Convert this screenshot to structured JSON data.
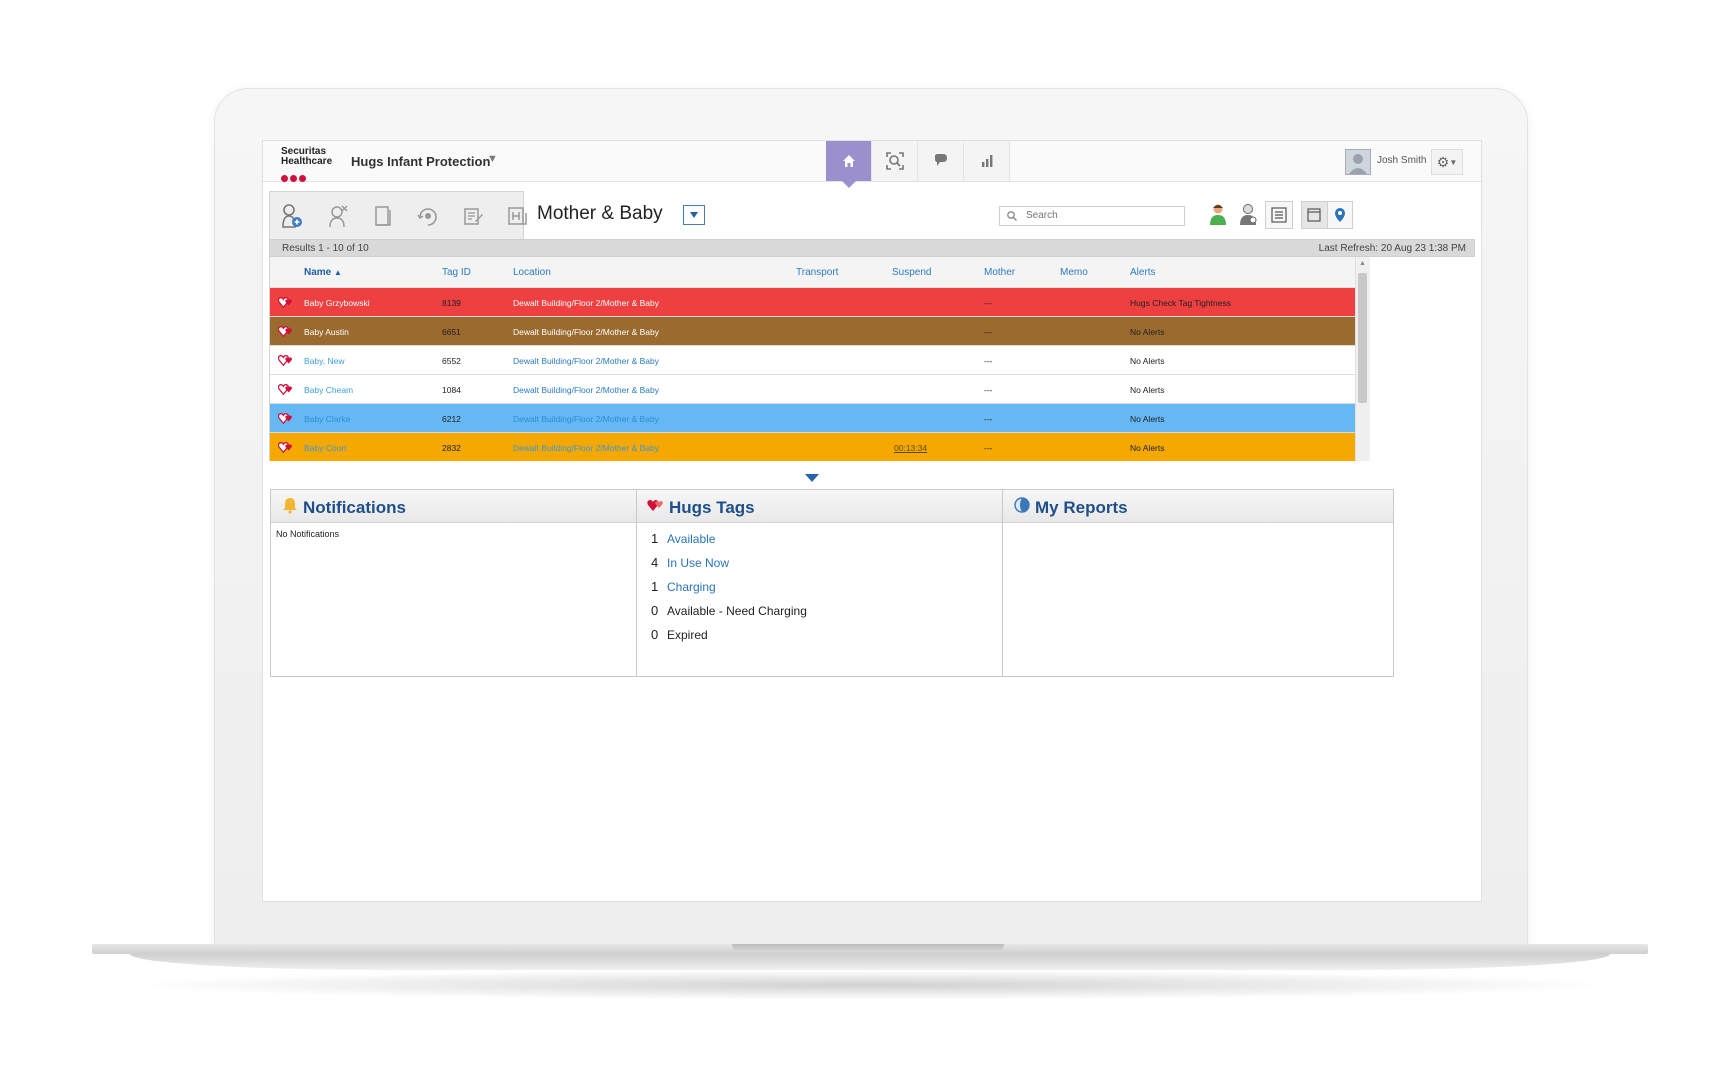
{
  "header": {
    "logo_line1": "Securitas",
    "logo_line2": "Healthcare",
    "app_title": "Hugs Infant Protection",
    "user_name": "Josh Smith",
    "nav_tabs": [
      "home-icon",
      "search-view-icon",
      "chat-icon",
      "reports-chart-icon"
    ]
  },
  "toolbar": {
    "unit_title": "Mother & Baby",
    "search_placeholder": "Search",
    "results_text": "Results 1 - 10 of 10",
    "last_refresh": "Last Refresh: 20 Aug 23 1:38 PM"
  },
  "table": {
    "columns": [
      "Name",
      "Tag ID",
      "Location",
      "Transport",
      "Suspend",
      "Mother",
      "Memo",
      "Alerts"
    ],
    "sort_indicator": "▲",
    "rows": [
      {
        "name": "Baby Grzybowski",
        "tag_id": "8139",
        "location": "Dewalt Building/Floor 2/Mother & Baby",
        "transport": "",
        "suspend": "",
        "mother": "---",
        "memo": "",
        "alerts": "Hugs Check Tag Tightness",
        "bg": "#ee4040",
        "name_color": "#ffffff",
        "loc_color": "#ffffff",
        "text_color": "#222222"
      },
      {
        "name": "Baby Austin",
        "tag_id": "6651",
        "location": "Dewalt Building/Floor 2/Mother & Baby",
        "transport": "",
        "suspend": "",
        "mother": "---",
        "memo": "",
        "alerts": "No Alerts",
        "bg": "#9a6a2e",
        "name_color": "#ffffff",
        "loc_color": "#ffffff",
        "text_color": "#222222"
      },
      {
        "name": "Baby, New",
        "tag_id": "6552",
        "location": "Dewalt Building/Floor 2/Mother & Baby",
        "transport": "",
        "suspend": "",
        "mother": "---",
        "memo": "",
        "alerts": "No Alerts",
        "bg": "#ffffff",
        "name_color": "#3aa0d6",
        "loc_color": "#2a7bc0",
        "text_color": "#222222"
      },
      {
        "name": "Baby Cheam",
        "tag_id": "1084",
        "location": "Dewalt Building/Floor 2/Mother & Baby",
        "transport": "",
        "suspend": "",
        "mother": "---",
        "memo": "",
        "alerts": "No Alerts",
        "bg": "#ffffff",
        "name_color": "#3aa0d6",
        "loc_color": "#2a7bc0",
        "text_color": "#222222"
      },
      {
        "name": "Baby Clarke",
        "tag_id": "6212",
        "location": "Dewalt Building/Floor 2/Mother & Baby",
        "transport": "",
        "suspend": "",
        "mother": "---",
        "memo": "",
        "alerts": "No Alerts",
        "bg": "#66b8f4",
        "name_color": "#2a8fd8",
        "loc_color": "#2a8fd8",
        "text_color": "#222222"
      },
      {
        "name": "Baby Court",
        "tag_id": "2832",
        "location": "Dewalt Building/Floor 2/Mother & Baby",
        "transport": "",
        "suspend": "00:13:34",
        "mother": "---",
        "memo": "",
        "alerts": "No Alerts",
        "bg": "#f5a800",
        "name_color": "#3a98d8",
        "loc_color": "#3a98d8",
        "text_color": "#222222"
      }
    ]
  },
  "panels": {
    "notifications": {
      "title": "Notifications",
      "empty_text": "No Notifications"
    },
    "hugs_tags": {
      "title": "Hugs Tags",
      "items": [
        {
          "count": "1",
          "label": "Available",
          "link": true
        },
        {
          "count": "4",
          "label": "In Use Now",
          "link": true
        },
        {
          "count": "1",
          "label": "Charging",
          "link": true
        },
        {
          "count": "0",
          "label": "Available - Need Charging",
          "link": false
        },
        {
          "count": "0",
          "label": "Expired",
          "link": false
        }
      ]
    },
    "my_reports": {
      "title": "My Reports"
    }
  },
  "colors": {
    "accent": "#9b8fce",
    "title_blue": "#1f4f8a",
    "link_blue": "#2a74bb"
  }
}
